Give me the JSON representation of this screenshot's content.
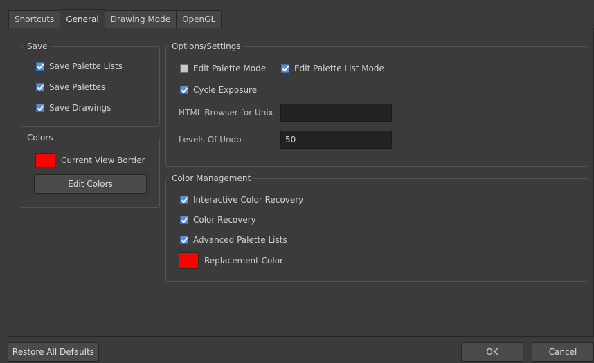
{
  "tabs": [
    {
      "label": "Shortcuts",
      "active": false
    },
    {
      "label": "General",
      "active": true
    },
    {
      "label": "Drawing Mode",
      "active": false
    },
    {
      "label": "OpenGL",
      "active": false
    }
  ],
  "save_group": {
    "title": "Save",
    "items": [
      {
        "label": "Save Palette Lists",
        "checked": true
      },
      {
        "label": "Save Palettes",
        "checked": true
      },
      {
        "label": "Save Drawings",
        "checked": true
      }
    ]
  },
  "colors_group": {
    "title": "Colors",
    "current_view_border_label": "Current View Border",
    "current_view_border_color": "#ff0000",
    "edit_colors_label": "Edit Colors"
  },
  "options_group": {
    "title": "Options/Settings",
    "edit_palette_mode": {
      "label": "Edit Palette Mode",
      "checked": false
    },
    "edit_palette_list_mode": {
      "label": "Edit Palette List Mode",
      "checked": true
    },
    "cycle_exposure": {
      "label": "Cycle Exposure",
      "checked": true
    },
    "html_browser_label": "HTML Browser for Unix",
    "html_browser_value": "",
    "levels_of_undo_label": "Levels Of Undo",
    "levels_of_undo_value": "50"
  },
  "color_mgmt_group": {
    "title": "Color Management",
    "items": [
      {
        "label": "Interactive Color Recovery",
        "checked": true
      },
      {
        "label": "Color Recovery",
        "checked": true
      },
      {
        "label": "Advanced Palette Lists",
        "checked": true
      }
    ],
    "replacement_color_label": "Replacement Color",
    "replacement_color": "#ff0000"
  },
  "footer": {
    "restore_label": "Restore All Defaults",
    "ok_label": "OK",
    "cancel_label": "Cancel"
  }
}
